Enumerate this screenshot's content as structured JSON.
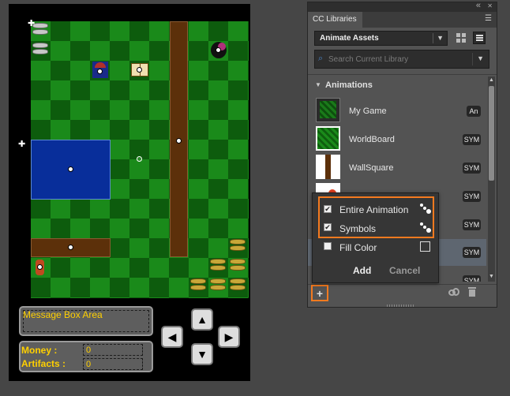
{
  "game": {
    "message_box_label": "Message Box Area",
    "money_label": "Money :",
    "money_value": "0",
    "artifacts_label": "Artifacts :",
    "artifacts_value": "0",
    "arrow_up": "▲",
    "arrow_down": "▼",
    "arrow_left": "◀",
    "arrow_right": "▶"
  },
  "library": {
    "panel_title": "CC Libraries",
    "library_selected": "Animate Assets",
    "search_placeholder": "Search Current Library",
    "section_label": "Animations",
    "collapse_glyph": "«",
    "close_glyph": "✕",
    "menu_glyph": "☰",
    "items": [
      {
        "name": "My Game",
        "badge": "An"
      },
      {
        "name": "WorldBoard",
        "badge": "SYM"
      },
      {
        "name": "WallSquare",
        "badge": "SYM"
      },
      {
        "name": "",
        "badge": "SYM"
      },
      {
        "name": "",
        "badge": "SYM"
      },
      {
        "name": "",
        "badge": "SYM"
      },
      {
        "name": "",
        "badge": "SYM"
      }
    ],
    "popup": {
      "option1": "Entire Animation",
      "option1_checked": true,
      "option2": "Symbols",
      "option2_checked": true,
      "option3": "Fill Color",
      "option3_checked": false,
      "add_label": "Add",
      "cancel_label": "Cancel"
    },
    "add_button_glyph": "+",
    "colors": {
      "accent": "#f47a1f",
      "text_yellow": "#ffd000"
    }
  }
}
